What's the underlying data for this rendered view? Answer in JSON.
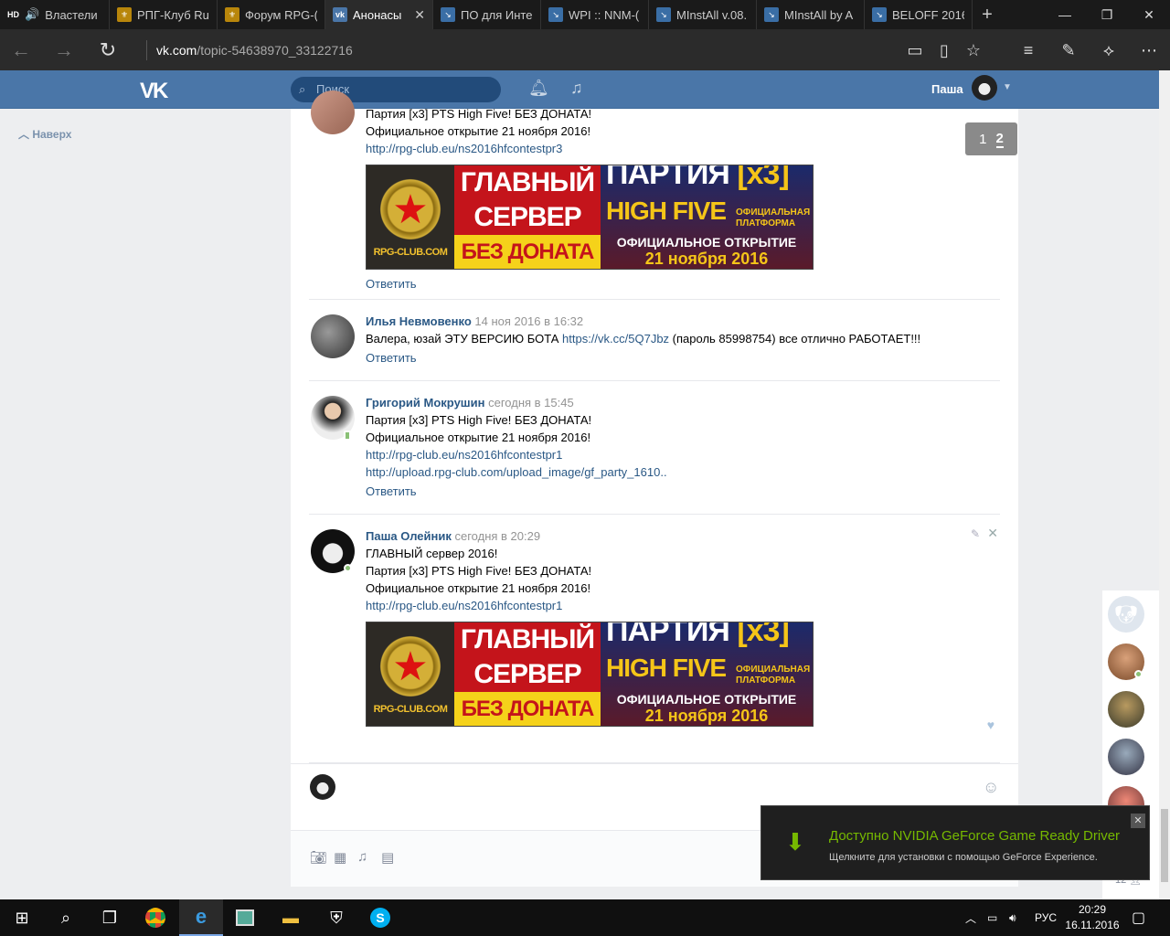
{
  "browser": {
    "tabs": [
      {
        "title": "Властели",
        "icon": "hd-audio",
        "color": "#333"
      },
      {
        "title": "РПГ-Клуб Ru",
        "icon": "rpg-crest",
        "color": "#b8860b"
      },
      {
        "title": "Форум RPG-(",
        "icon": "rpg-crest",
        "color": "#b8860b"
      },
      {
        "title": "Анонасы",
        "icon": "vk",
        "color": "#4a76a8"
      },
      {
        "title": "ПО для Инте",
        "icon": "download",
        "color": "#3a6ea5"
      },
      {
        "title": "WPI :: NNM-(",
        "icon": "download",
        "color": "#3a6ea5"
      },
      {
        "title": "MInstAll v.08.",
        "icon": "download",
        "color": "#3a6ea5"
      },
      {
        "title": "MInstAll by A",
        "icon": "download",
        "color": "#3a6ea5"
      },
      {
        "title": "BELOFF 2016.",
        "icon": "download",
        "color": "#3a6ea5"
      }
    ],
    "tab_prefix": "HD",
    "url_domain": "vk.com",
    "url_rest": "/topic-54638970_33122716"
  },
  "vk": {
    "logo": "VK",
    "search_placeholder": "Поиск",
    "username": "Паша",
    "up_label": "Наверх"
  },
  "pager": {
    "pages": [
      "1",
      "2"
    ],
    "current": "2"
  },
  "posts": [
    {
      "author": "",
      "date": "",
      "lines": [
        "Партия [x3] PTS High Five! БЕЗ ДОНАТА!",
        "Официальное открытие 21 ноября 2016!"
      ],
      "links": [
        "http://rpg-club.eu/ns2016hfcontestpr3"
      ],
      "has_banner": true,
      "reply": "Ответить"
    },
    {
      "author": "Илья Невмовенко",
      "date": "14 ноя 2016 в 16:32",
      "text_before": "Валера, юзай ЭТУ ВЕРСИЮ БОТА ",
      "link": "https://vk.cc/5Q7Jbz",
      "text_after": " (пароль 85998754) все отлично РАБОТАЕТ!!!",
      "reply": "Ответить"
    },
    {
      "author": "Григорий Мокрушин",
      "date": "сегодня в 15:45",
      "lines": [
        "Партия [x3] PTS High Five! БЕЗ ДОНАТА!",
        "Официальное открытие 21 ноября 2016!"
      ],
      "links": [
        "http://rpg-club.eu/ns2016hfcontestpr1",
        "http://upload.rpg-club.com/upload_image/gf_party_1610.."
      ],
      "reply": "Ответить"
    },
    {
      "author": "Паша Олейник",
      "date": "сегодня в 20:29",
      "lines": [
        "ГЛАВНЫЙ сервер 2016!",
        "Партия [x3] PTS High Five! БЕЗ ДОНАТА!",
        "Официальное открытие 21 ноября 2016!"
      ],
      "links": [
        "http://rpg-club.eu/ns2016hfcontestpr1"
      ],
      "has_banner": true
    }
  ],
  "banner": {
    "site": "RPG-CLUB.COM",
    "main1": "ГЛАВНЫЙ",
    "main2": "СЕРВЕР",
    "nodonate": "БЕЗ ДОНАТА",
    "party": "ПАРТИЯ",
    "x3": "[x3]",
    "hf": "HIGH FIVE",
    "platform1": "ОФИЦИАЛЬНАЯ",
    "platform2": "ПЛАТФОРМА",
    "open": "ОФИЦИАЛЬНОЕ ОТКРЫТИЕ",
    "date": "21 ноября 2016"
  },
  "friends": {
    "count": "12"
  },
  "nvidia": {
    "title": "Доступно NVIDIA GeForce Game Ready Driver",
    "subtitle": "Щелкните для установки с помощью GeForce Experience."
  },
  "taskbar": {
    "language": "РУС",
    "time": "20:29",
    "date": "16.11.2016"
  },
  "colors": {
    "vk_blue": "#4a76a8",
    "link": "#2a5885",
    "nvidia_green": "#76b900"
  }
}
